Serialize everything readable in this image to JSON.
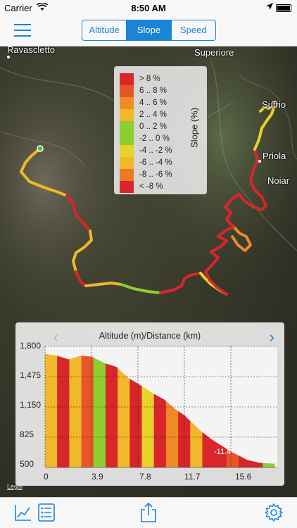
{
  "status": {
    "carrier": "Carrier",
    "time": "8:50 AM"
  },
  "nav": {
    "tabs": [
      "Altitude",
      "Slope",
      "Speed"
    ],
    "active": "Slope"
  },
  "map": {
    "places": {
      "ravascletto": "Ravascletto",
      "superiore": "Superiore",
      "sutrio": "Sutrio",
      "priola": "Priola",
      "noiaris": "Noiar"
    },
    "legal": "Legal"
  },
  "legend": {
    "title": "Slope (%)",
    "items": [
      {
        "label": "> 8 %",
        "color": "#d8262a"
      },
      {
        "label": "6 .. 8 %",
        "color": "#e7562a"
      },
      {
        "label": "4 .. 6 %",
        "color": "#ee8a28"
      },
      {
        "label": "2 .. 4 %",
        "color": "#f0b82a"
      },
      {
        "label": "0 .. 2 %",
        "color": "#8dcf2f"
      },
      {
        "label": "-2 .. 0 %",
        "color": "#8dcf2f"
      },
      {
        "label": "-4 .. -2 %",
        "color": "#e8d22c"
      },
      {
        "label": "-6 .. -4 %",
        "color": "#f0b82a"
      },
      {
        "label": "-8 .. -6 %",
        "color": "#ee7a28"
      },
      {
        "label": "< -8 %",
        "color": "#d8262a"
      }
    ]
  },
  "chart": {
    "title": "Altitude (m)/Distance (km)",
    "y_ticks": [
      "1,800",
      "1,475",
      "1,150",
      "825",
      "500"
    ],
    "x_ticks": [
      "0",
      "3.9",
      "7.8",
      "11.7",
      "15.6"
    ],
    "min_label": "-11.4"
  },
  "chart_data": {
    "type": "area",
    "title": "Altitude (m)/Distance (km)",
    "xlabel": "Distance (km)",
    "ylabel": "Altitude (m)",
    "xlim": [
      0,
      19.5
    ],
    "ylim": [
      500,
      1800
    ],
    "x": [
      0,
      1,
      2,
      3,
      3.9,
      5,
      6,
      7,
      7.8,
      9,
      10,
      11,
      11.7,
      13,
      14,
      15,
      15.6,
      17,
      18,
      19.3
    ],
    "y": [
      1720,
      1700,
      1660,
      1700,
      1690,
      1620,
      1580,
      1460,
      1400,
      1300,
      1230,
      1120,
      1060,
      900,
      800,
      720,
      670,
      580,
      550,
      540
    ]
  },
  "toolbar": {
    "icons": [
      "chart-icon",
      "list-icon",
      "share-icon",
      "settings-icon"
    ]
  }
}
